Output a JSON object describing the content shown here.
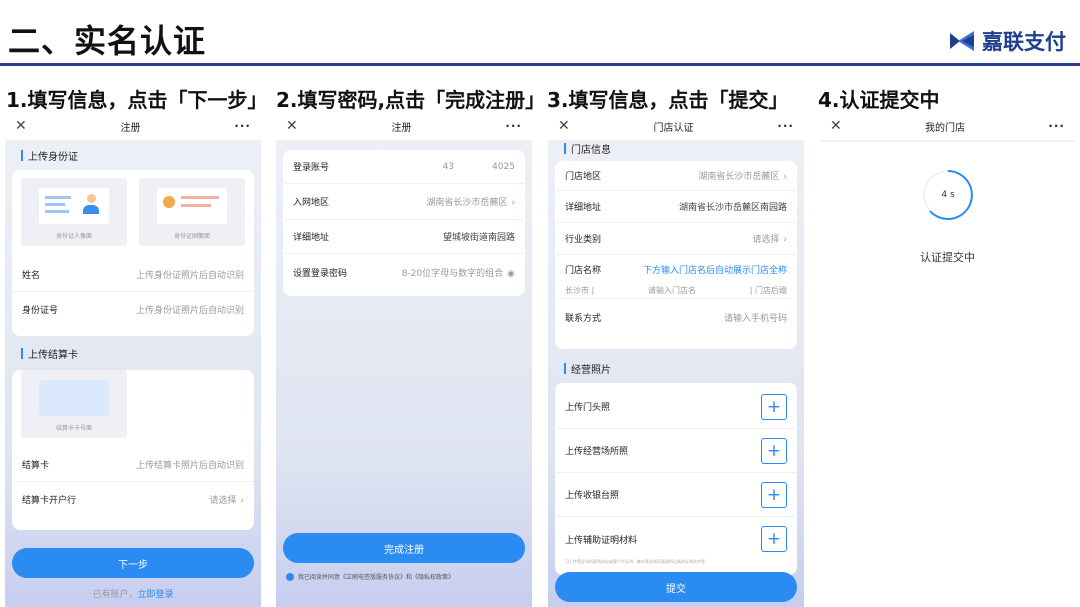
{
  "title": "二、实名认证",
  "brand": "嘉联支付",
  "steps": [
    "1.填写信息，点击「下一步」",
    "2.填写密码,点击「完成注册」",
    "3.填写信息，点击「提交」",
    "4.认证提交中"
  ],
  "s1": {
    "nav_title": "注册",
    "sec_id": "上传身份证",
    "id_front": "身份证人像面",
    "id_back": "身份证国徽面",
    "name_label": "姓名",
    "name_ph": "上传身份证照片后自动识别",
    "idno_label": "身份证号",
    "idno_ph": "上传身份证照片后自动识别",
    "sec_card": "上传结算卡",
    "card_img": "结算卡卡号面",
    "card_label": "结算卡",
    "card_ph": "上传结算卡照片后自动识别",
    "bank_label": "结算卡开户行",
    "bank_ph": "请选择",
    "next": "下一步",
    "login_pre": "已有账户，",
    "login_link": "立即登录"
  },
  "s2": {
    "nav_title": "注册",
    "acct_label": "登录账号",
    "acct_val1": "43",
    "acct_val2": "4025",
    "area_label": "入网地区",
    "area_val": "湖南省长沙市岳麓区",
    "addr_label": "详细地址",
    "addr_val": "望城坡街道南园路",
    "pwd_label": "设置登录密码",
    "pwd_ph": "8-20位字母与数字的组合",
    "finish": "完成注册",
    "agree": "我已阅读并同意《立刷电签版服务协议》和《隐私权政策》"
  },
  "s3": {
    "nav_title": "门店认证",
    "sec_store": "门店信息",
    "area_label": "门店地区",
    "area_val": "湖南省长沙市岳麓区",
    "addr_label": "详细地址",
    "addr_val": "湖南省长沙市岳麓区南园路",
    "ind_label": "行业类别",
    "ind_ph": "请选择",
    "sname_label": "门店名称",
    "sname_hint": "下方输入门店名后自动展示门店全称",
    "pre": "长沙市 |",
    "mid": "请输入门店名",
    "suf": "| 门店后缀",
    "contact_label": "联系方式",
    "contact_ph": "请输入手机号码",
    "sec_photo": "经营照片",
    "up1": "上传门头照",
    "up2": "上传经营场所照",
    "up3": "上传收银台照",
    "up4": "上传辅助证明材料",
    "note": "可上传营业场所租赁协议或客户代证明，集中营业场所管理所出具的证明文件等",
    "submit": "提交"
  },
  "s4": {
    "nav_title": "我的门店",
    "timer": "4 s",
    "status": "认证提交中"
  }
}
